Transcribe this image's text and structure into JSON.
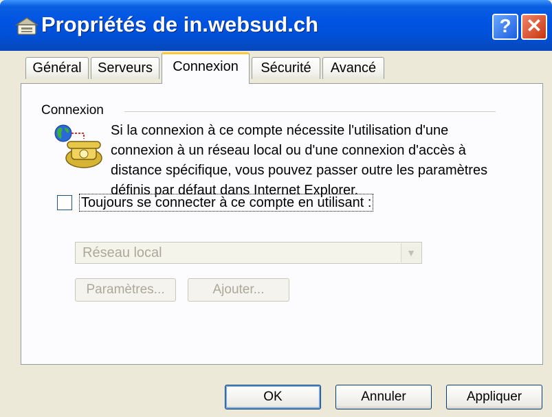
{
  "window": {
    "title": "Propriétés de in.websud.ch",
    "help_label": "?",
    "close_label": "✕"
  },
  "tabs": [
    {
      "label": "Général"
    },
    {
      "label": "Serveurs"
    },
    {
      "label": "Connexion",
      "active": true
    },
    {
      "label": "Sécurité"
    },
    {
      "label": "Avancé"
    }
  ],
  "connection": {
    "group_label": "Connexion",
    "description": "Si la connexion à ce compte nécessite l'utilisation d'une connexion à un réseau local ou d'une connexion d'accès à distance spécifique, vous pouvez passer outre les paramètres définis par défaut dans Internet Explorer.",
    "always_connect_label": "Toujours se connecter à ce compte en utilisant :",
    "always_connect_checked": false,
    "select_value": "Réseau local",
    "settings_label": "Paramètres...",
    "add_label": "Ajouter..."
  },
  "footer": {
    "ok_label": "OK",
    "cancel_label": "Annuler",
    "apply_label": "Appliquer"
  }
}
